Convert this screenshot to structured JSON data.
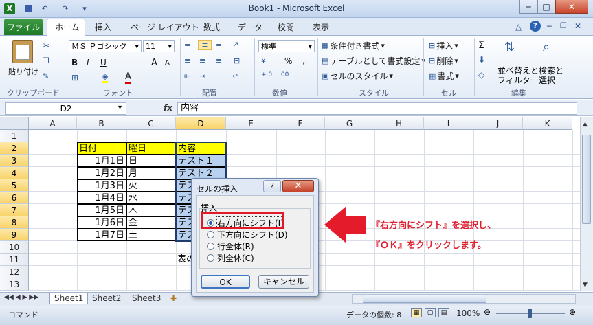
{
  "window": {
    "title": "Book1 - Microsoft Excel",
    "minimize": "─",
    "maximize": "□",
    "close": "✕"
  },
  "quick_access": [
    "excel-logo-icon",
    "save-icon",
    "undo-icon",
    "redo-icon",
    "customize-icon"
  ],
  "tabs": {
    "file": "ファイル",
    "items": [
      "ホーム",
      "挿入",
      "ページ レイアウト",
      "数式",
      "データ",
      "校閲",
      "表示"
    ]
  },
  "ribbon": {
    "clipboard": {
      "label": "クリップボード",
      "paste": "貼り付け"
    },
    "font": {
      "label": "フォント",
      "name": "ＭＳ Ｐゴシック",
      "size": "11",
      "bold": "B",
      "italic": "I",
      "underline": "U",
      "grow": "A",
      "shrink": "A"
    },
    "alignment": {
      "label": "配置"
    },
    "number": {
      "label": "数値",
      "format": "標準",
      "percent": "%",
      "comma": ","
    },
    "styles": {
      "label": "スタイル",
      "conditional": "条件付き書式",
      "table": "テーブルとして書式設定",
      "cell_styles": "セルのスタイル"
    },
    "cells": {
      "label": "セル",
      "insert": "挿入",
      "delete": "削除",
      "format": "書式"
    },
    "editing": {
      "label": "編集",
      "sort_line1": "並べ替えと",
      "sort_line2": "フィルター",
      "find_line1": "検索と",
      "find_line2": "選択"
    }
  },
  "formula_bar": {
    "name_box": "D2",
    "fx": "fx",
    "value": "内容"
  },
  "columns": [
    "A",
    "B",
    "C",
    "D",
    "E",
    "F",
    "G",
    "H",
    "I",
    "J",
    "K"
  ],
  "rows": [
    "1",
    "2",
    "3",
    "4",
    "5",
    "6",
    "7",
    "8",
    "9",
    "10",
    "11",
    "12",
    "13"
  ],
  "table": {
    "headers": [
      "日付",
      "曜日",
      "内容"
    ],
    "dates": [
      "1月1日",
      "1月2日",
      "1月3日",
      "1月4日",
      "1月5日",
      "1月6日",
      "1月7日"
    ],
    "days": [
      "日",
      "月",
      "火",
      "水",
      "木",
      "金",
      "土"
    ],
    "contents": [
      "テスト１",
      "テスト２",
      "テス",
      "テス",
      "テス",
      "テス",
      "テス"
    ]
  },
  "partial_text": "表の",
  "sheets": [
    "Sheet1",
    "Sheet2",
    "Sheet3"
  ],
  "status": {
    "mode": "コマンド",
    "count": "データの個数: 8",
    "zoom": "100%"
  },
  "dialog": {
    "title": "セルの挿入",
    "help": "?",
    "close": "✕",
    "group": "挿入",
    "options": [
      "右方向にシフト(I)",
      "下方向にシフト(D)",
      "行全体(R)",
      "列全体(C)"
    ],
    "selected": 0,
    "ok": "OK",
    "cancel": "キャンセル"
  },
  "annotation": {
    "line1": "『右方向にシフト』を選択し、",
    "line2": "『ＯＫ』をクリックします。",
    "color": "#e02030"
  }
}
